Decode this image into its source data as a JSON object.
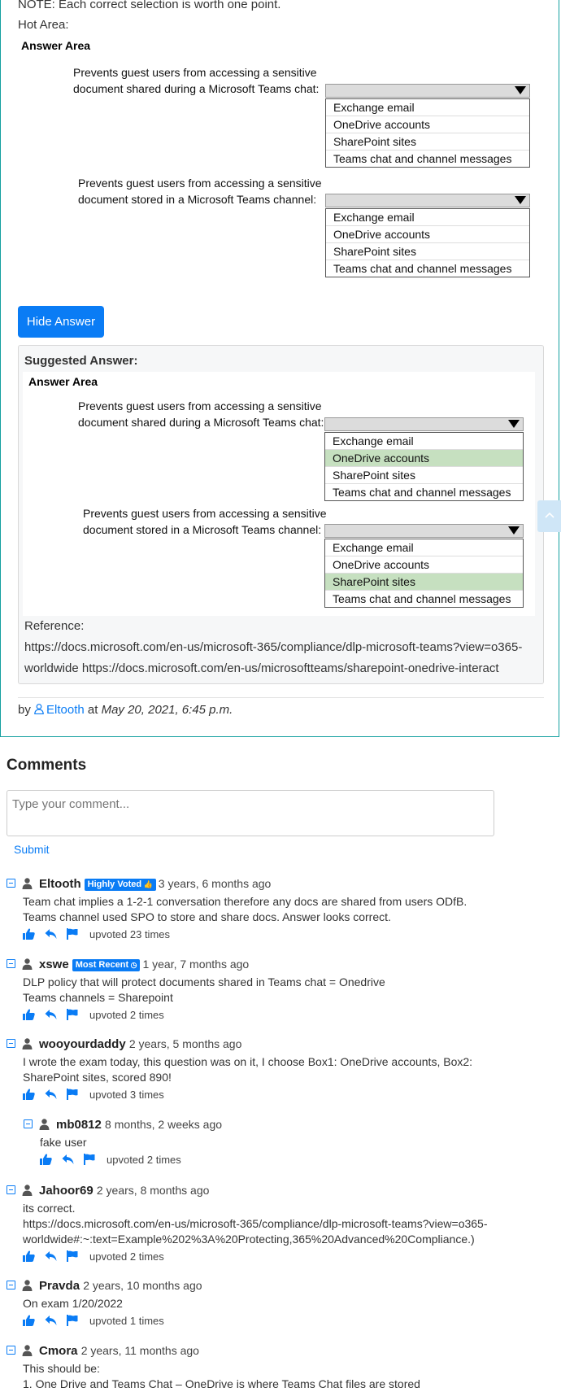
{
  "question": {
    "note": "NOTE: Each correct selection is worth one point.",
    "hot_area_label": "Hot Area:",
    "answer_area_label": "Answer Area",
    "statements": [
      {
        "line1": "Prevents guest users from accessing a sensitive",
        "line2": "document shared during a Microsoft Teams chat:"
      },
      {
        "line1": "Prevents guest users from accessing a sensitive",
        "line2": "document stored in a Microsoft Teams channel:"
      }
    ],
    "options": [
      "Exchange email",
      "OneDrive accounts",
      "SharePoint sites",
      "Teams chat and channel messages"
    ]
  },
  "hide_answer_label": "Hide Answer",
  "suggested": {
    "title": "Suggested Answer:",
    "answer_area_label": "Answer Area",
    "statements": [
      {
        "line1": "Prevents guest users from accessing a sensitive",
        "line2": "document shared during a Microsoft Teams chat:"
      },
      {
        "line1": "Prevents guest users from accessing a sensitive",
        "line2": "document stored in a Microsoft Teams channel:"
      }
    ],
    "options": [
      "Exchange email",
      "OneDrive accounts",
      "SharePoint sites",
      "Teams chat and channel messages"
    ],
    "selected": [
      "OneDrive accounts",
      "SharePoint sites"
    ],
    "selected_color": "#c6e0c0",
    "reference_label": "Reference:",
    "reference_text": "https://docs.microsoft.com/en-us/microsoft-365/compliance/dlp-microsoft-teams?view=o365-worldwide https://docs.microsoft.com/en-us/microsoftteams/sharepoint-onedrive-interact"
  },
  "byline": {
    "prefix": "by",
    "user": "Eltooth",
    "at": "at",
    "date": "May 20, 2021, 6:45 p.m."
  },
  "comments_section": {
    "title": "Comments",
    "placeholder": "Type your comment...",
    "submit_label": "Submit"
  },
  "comments": [
    {
      "user": "Eltooth",
      "badge": "Highly Voted",
      "time": "3 years, 6 months ago",
      "lines": [
        "Team chat implies a 1-2-1 conversation therefore any docs are shared from users ODfB.",
        "Teams channel used SPO to store and share docs. Answer looks correct."
      ],
      "votes": "upvoted 23 times"
    },
    {
      "user": "xswe",
      "badge": "Most Recent",
      "time": "1 year, 7 months ago",
      "lines": [
        "DLP policy that will protect documents shared in Teams chat = Onedrive",
        "Teams channels = Sharepoint"
      ],
      "votes": "upvoted 2 times"
    },
    {
      "user": "wooyourdaddy",
      "badge": "",
      "time": "2 years, 5 months ago",
      "lines": [
        "I wrote the exam today, this question was on it, I choose Box1: OneDrive accounts, Box2:",
        "SharePoint sites, scored 890!"
      ],
      "votes": "upvoted 3 times"
    },
    {
      "user": "mb0812",
      "badge": "",
      "time": "8 months, 2 weeks ago",
      "lines": [
        "fake user"
      ],
      "votes": "upvoted 2 times"
    },
    {
      "user": "Jahoor69",
      "badge": "",
      "time": "2 years, 8 months ago",
      "lines": [
        "its correct.",
        "https://docs.microsoft.com/en-us/microsoft-365/compliance/dlp-microsoft-teams?view=o365-",
        "worldwide#:~:text=Example%202%3A%20Protecting,365%20Advanced%20Compliance.)"
      ],
      "votes": "upvoted 2 times"
    },
    {
      "user": "Pravda",
      "badge": "",
      "time": "2 years, 10 months ago",
      "lines": [
        "On exam 1/20/2022"
      ],
      "votes": "upvoted 1 times"
    },
    {
      "user": "Cmora",
      "badge": "",
      "time": "2 years, 11 months ago",
      "lines": [
        "This should be:",
        "1. One Drive and Teams Chat – OneDrive is where Teams Chat files are stored"
      ],
      "votes": ""
    }
  ],
  "colors": {
    "accent": "#0a7cf5",
    "card_border": "#14a0a0"
  }
}
